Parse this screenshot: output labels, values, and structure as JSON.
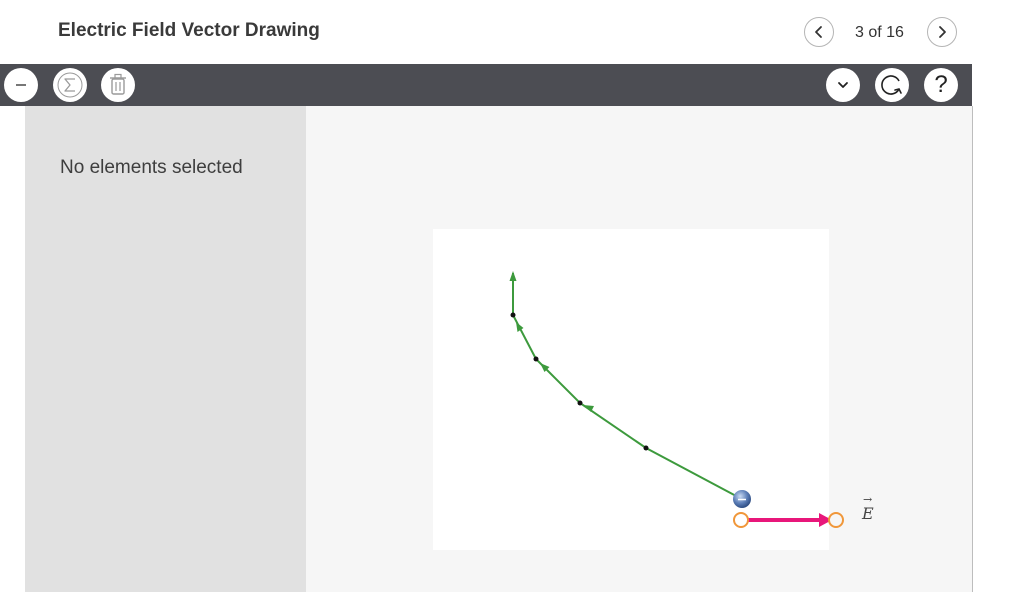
{
  "header": {
    "title": "Electric Field Vector Drawing",
    "pager": {
      "current": 3,
      "total": 16,
      "label": "3 of 16"
    }
  },
  "toolbar": {
    "left_icons": [
      "minus-icon",
      "sigma-icon",
      "trash-icon"
    ],
    "right_icons": [
      "chevron-down-icon",
      "reset-icon",
      "help-icon"
    ]
  },
  "left_panel": {
    "message": "No elements selected"
  },
  "canvas": {
    "vector_label": "E",
    "colors": {
      "field_line": "#3d9a3d",
      "vector": "#e8177a",
      "handle": "#f0973a",
      "charge": "#4a6fa8"
    }
  }
}
